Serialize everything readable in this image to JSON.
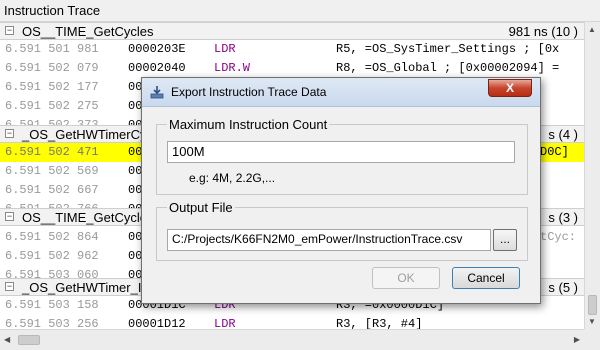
{
  "panel": {
    "title": "Instruction Trace"
  },
  "groups": [
    {
      "function": "OS__TIME_GetCycles",
      "time": "981 ns (10 )"
    },
    {
      "function": "_OS_GetHWTimerCyc",
      "time": "s (4 )"
    },
    {
      "function": "OS__TIME_GetCycle",
      "time": "s (3 )"
    },
    {
      "function": "_OS_GetHWTimer_I",
      "time": "s (5 )"
    }
  ],
  "rows": [
    {
      "ts": "6.591 501 981",
      "addr": "0000203E",
      "op": "LDR",
      "arg": "R5, =OS_SysTimer_Settings ; [0x"
    },
    {
      "ts": "6.591 502 079",
      "addr": "00002040",
      "op": "LDR.W",
      "arg": "R8, =OS_Global ; [0x00002094] ="
    },
    {
      "ts": "6.591 502 177",
      "addr": "00",
      "op": "",
      "arg": ""
    },
    {
      "ts": "6.591 502 275",
      "addr": "00",
      "op": "",
      "arg": ""
    },
    {
      "ts": "6.591 502 373",
      "addr": "00",
      "op": "",
      "arg": ""
    },
    {
      "ts": "6.591 502 471",
      "addr": "00",
      "op": "",
      "arg": "D0C]"
    },
    {
      "ts": "6.591 502 569",
      "addr": "00",
      "op": "",
      "arg": ""
    },
    {
      "ts": "6.591 502 667",
      "addr": "00",
      "op": "",
      "arg": ""
    },
    {
      "ts": "6.591 502 766",
      "addr": "00",
      "op": "",
      "arg": ""
    },
    {
      "ts": "6.591 502 864",
      "addr": "00",
      "op": "",
      "arg": "tCyc:"
    },
    {
      "ts": "6.591 502 962",
      "addr": "00",
      "op": "",
      "arg": ""
    },
    {
      "ts": "6.591 503 060",
      "addr": "00",
      "op": "",
      "arg": ""
    },
    {
      "ts": "6.591 503 158",
      "addr": "00001D1C",
      "op": "LDR",
      "arg": "R3, =0x0000D1C]"
    },
    {
      "ts": "6.591 503 256",
      "addr": "00001D12",
      "op": "LDR",
      "arg": "R3, [R3, #4]"
    }
  ],
  "dialog": {
    "title": "Export Instruction Trace Data",
    "close_label": "X",
    "max_count_legend": "Maximum Instruction Count",
    "max_count_value": "100M",
    "max_count_hint": "e.g:   4M,     2.2G,...",
    "output_legend": "Output File",
    "output_value": "C:/Projects/K66FN2M0_emPower/InstructionTrace.csv",
    "browse_label": "...",
    "ok_label": "OK",
    "cancel_label": "Cancel"
  },
  "colors": {
    "highlight": "#ffff00",
    "opcode": "#8b008b",
    "timestamp": "#9a9a9a"
  }
}
